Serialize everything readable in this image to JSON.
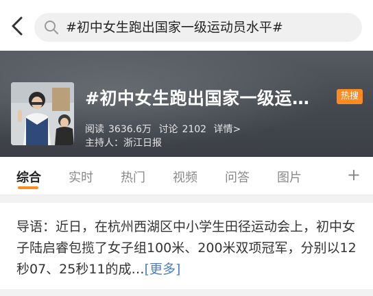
{
  "search": {
    "query": "#初中女生跑出国家一级运动员水平#"
  },
  "header": {
    "title": "#初中女生跑出国家一级运…",
    "badge": "热搜",
    "reads_label": "阅读",
    "reads_value": "3636.6万",
    "discuss_label": "讨论",
    "discuss_value": "2102",
    "details": "详情>",
    "host_label": "主持人：",
    "host_name": "浙江日报"
  },
  "tabs": [
    {
      "label": "综合",
      "active": true
    },
    {
      "label": "实时"
    },
    {
      "label": "热门"
    },
    {
      "label": "视频"
    },
    {
      "label": "问答"
    },
    {
      "label": "图片"
    }
  ],
  "tab_add": "+",
  "intro": {
    "text": "导语：近日，在杭州西湖区中小学生田径运动会上，初中女子陆启睿包揽了女子组100米、200米双项冠军，分别以12秒07、25秒11的成…",
    "more": "[更多]"
  },
  "colors": {
    "accent": "#ff8a1f",
    "link": "#4a7fc1",
    "hero_bg": "#4a4f55"
  },
  "icons": {
    "back": "chevron-left-icon",
    "search": "search-icon"
  }
}
